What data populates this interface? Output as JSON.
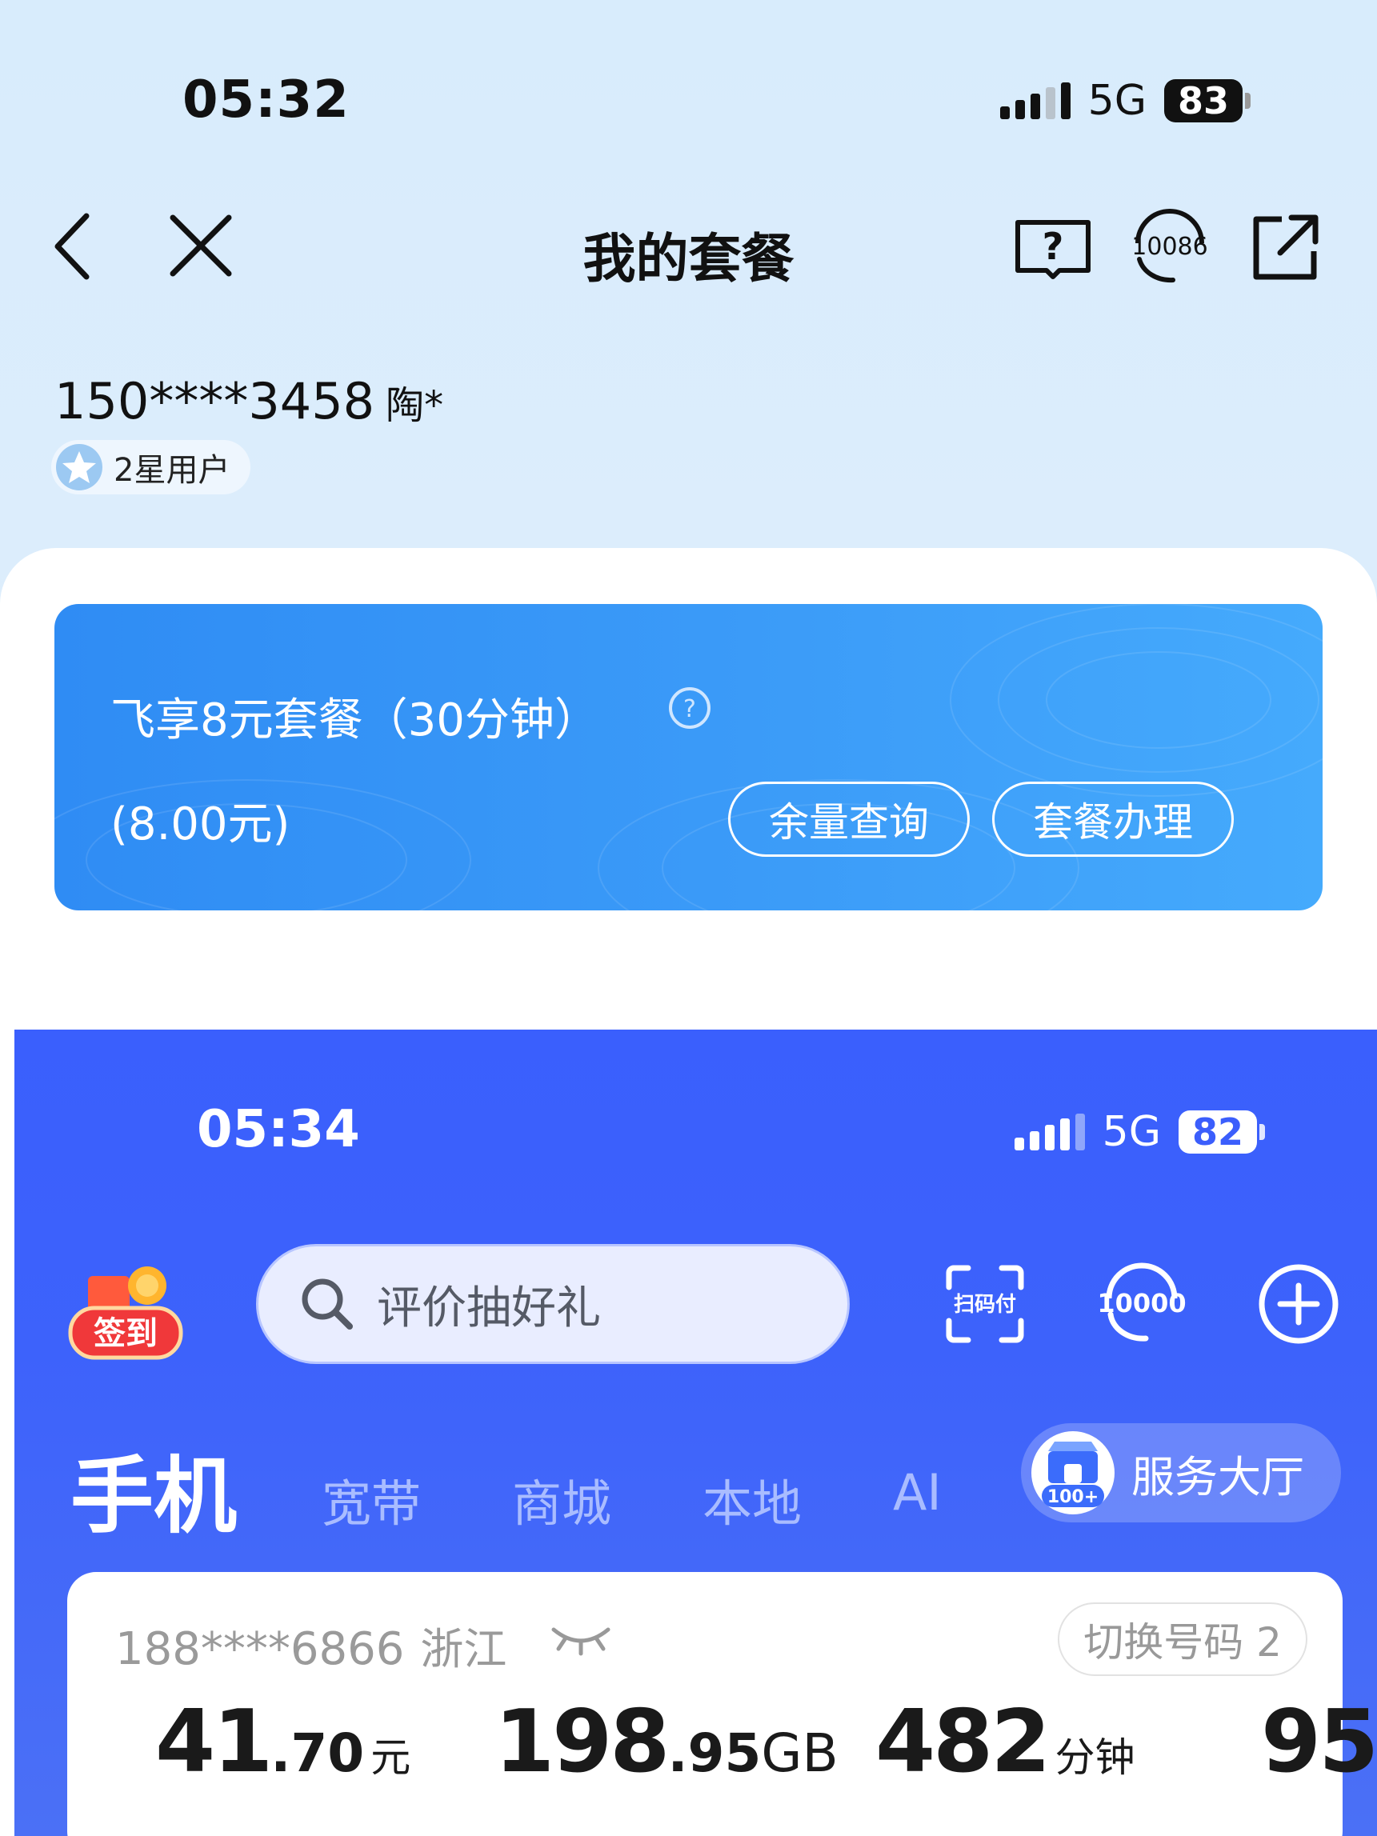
{
  "screen1": {
    "status": {
      "time": "05:32",
      "network": "5G",
      "battery": "83"
    },
    "nav": {
      "title": "我的套餐"
    },
    "user": {
      "phone": "150****3458",
      "name": "陶*",
      "level": "2星用户"
    },
    "plan": {
      "name": "飞享8元套餐（30分钟）",
      "price": "(8.00元)",
      "btn_balance": "余量查询",
      "btn_manage": "套餐办理"
    }
  },
  "screen2": {
    "status": {
      "time": "05:34",
      "network": "5G",
      "battery": "82"
    },
    "signin_label": "签到",
    "search": {
      "placeholder": "评价抽好礼"
    },
    "tools": {
      "scan_pay": "扫码付",
      "hotline": "10000"
    },
    "tabs": [
      "手机",
      "宽带",
      "商城",
      "本地",
      "AI"
    ],
    "service_hall": {
      "label": "服务大厅",
      "badge": "100+"
    },
    "account": {
      "phone": "188****6866",
      "province": "浙江",
      "switch_label": "切换号码 2",
      "stats": [
        {
          "int": "41",
          "dec": ".70",
          "unit": "元"
        },
        {
          "int": "198",
          "dec": ".95",
          "unit": "GB"
        },
        {
          "int": "482",
          "dec": "",
          "unit": "分钟"
        },
        {
          "int": "95",
          "dec": "",
          "unit": ""
        }
      ]
    }
  },
  "colors": {
    "screen1_bg": "#d8ecfc",
    "plan_card": "#3b9bf8",
    "screen2_bg": "#3a5ffd"
  },
  "icons": [
    "back-chevron-icon",
    "close-icon",
    "help-book-icon",
    "headset-10086-icon",
    "share-icon",
    "star-badge-icon",
    "question-circle-icon",
    "search-icon",
    "scan-pay-icon",
    "headset-10000-icon",
    "plus-circle-icon",
    "eye-closed-icon",
    "store-icon"
  ]
}
